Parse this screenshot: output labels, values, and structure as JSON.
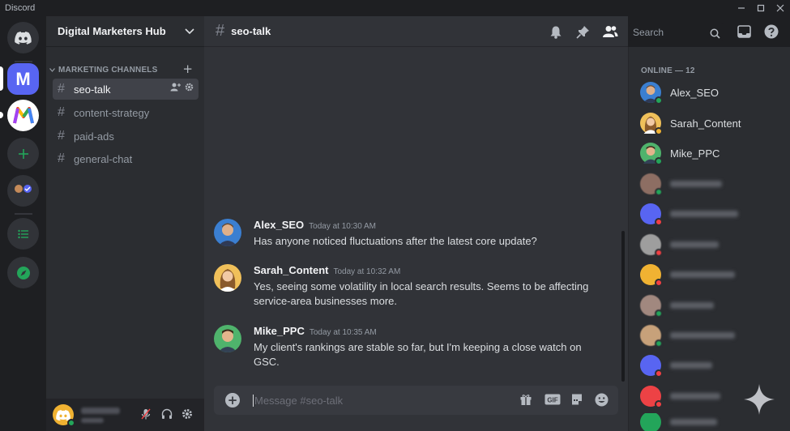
{
  "app": {
    "title": "Discord"
  },
  "colors": {
    "accent": "#5865f2",
    "online": "#23a55a",
    "idle": "#f0b232",
    "dnd": "#f23f43"
  },
  "rail": {
    "servers": [
      {
        "name": "home",
        "icon": "discord-logo-icon"
      },
      {
        "name": "M",
        "letter": "M",
        "active": true
      },
      {
        "name": "colorful-m-server",
        "icon": "m-logo-icon"
      },
      {
        "name": "add-server",
        "icon": "plus-icon"
      },
      {
        "name": "group-server",
        "icon": "group-avatar-icon"
      },
      {
        "name": "server-list",
        "icon": "list-icon"
      },
      {
        "name": "discover",
        "icon": "compass-icon"
      }
    ]
  },
  "sidebar": {
    "server_name": "Digital Marketers Hub",
    "category": "MARKETING CHANNELS",
    "channels": [
      {
        "name": "seo-talk",
        "active": true
      },
      {
        "name": "content-strategy"
      },
      {
        "name": "paid-ads"
      },
      {
        "name": "general-chat"
      }
    ]
  },
  "chat": {
    "channel": "seo-talk",
    "composer_placeholder": "Message #seo-talk",
    "messages": [
      {
        "author": "Alex_SEO",
        "time": "Today at 10:30 AM",
        "text": "Has anyone noticed fluctuations after the latest core update?"
      },
      {
        "author": "Sarah_Content",
        "time": "Today at 10:32 AM",
        "text": "Yes, seeing some volatility in local search results. Seems to be affecting service-area businesses more."
      },
      {
        "author": "Mike_PPC",
        "time": "Today at 10:35 AM",
        "text": "My client's rankings are stable so far, but I'm keeping a close watch on GSC."
      }
    ]
  },
  "header": {
    "search_placeholder": "Search"
  },
  "members": {
    "heading": "ONLINE — 12",
    "list": [
      {
        "name": "Alex_SEO",
        "status": "online"
      },
      {
        "name": "Sarah_Content",
        "status": "idle"
      },
      {
        "name": "Mike_PPC",
        "status": "online"
      }
    ]
  }
}
